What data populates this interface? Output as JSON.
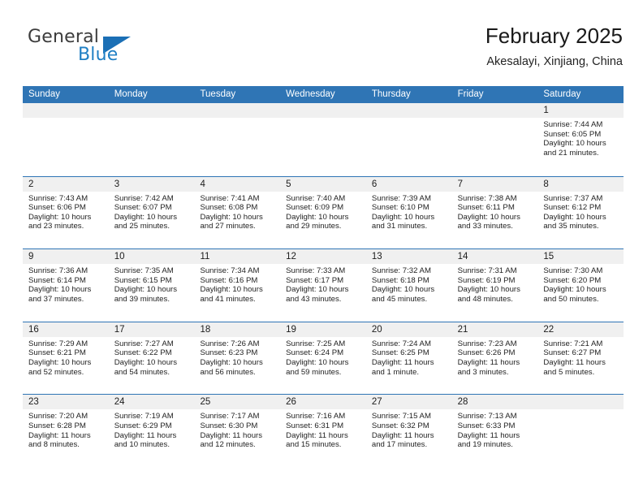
{
  "logo": {
    "text_top": "General",
    "text_bottom": "Blue",
    "colors": {
      "dark": "#3c3c3c",
      "blue": "#1f7fc4",
      "triangle": "#1b6fb5"
    }
  },
  "header": {
    "title": "February 2025",
    "subtitle": "Akesalayi, Xinjiang, China"
  },
  "theme": {
    "header_blue": "#2f75b5",
    "day_band_gray": "#f0f0f0",
    "text": "#232323"
  },
  "calendar": {
    "weekday_headers": [
      "Sunday",
      "Monday",
      "Tuesday",
      "Wednesday",
      "Thursday",
      "Friday",
      "Saturday"
    ],
    "labels": {
      "sunrise": "Sunrise:",
      "sunset": "Sunset:",
      "daylight": "Daylight:"
    },
    "weeks": [
      [
        {
          "day": ""
        },
        {
          "day": ""
        },
        {
          "day": ""
        },
        {
          "day": ""
        },
        {
          "day": ""
        },
        {
          "day": ""
        },
        {
          "day": "1",
          "sunrise": "Sunrise: 7:44 AM",
          "sunset": "Sunset: 6:05 PM",
          "daylight": "Daylight: 10 hours and 21 minutes."
        }
      ],
      [
        {
          "day": "2",
          "sunrise": "Sunrise: 7:43 AM",
          "sunset": "Sunset: 6:06 PM",
          "daylight": "Daylight: 10 hours and 23 minutes."
        },
        {
          "day": "3",
          "sunrise": "Sunrise: 7:42 AM",
          "sunset": "Sunset: 6:07 PM",
          "daylight": "Daylight: 10 hours and 25 minutes."
        },
        {
          "day": "4",
          "sunrise": "Sunrise: 7:41 AM",
          "sunset": "Sunset: 6:08 PM",
          "daylight": "Daylight: 10 hours and 27 minutes."
        },
        {
          "day": "5",
          "sunrise": "Sunrise: 7:40 AM",
          "sunset": "Sunset: 6:09 PM",
          "daylight": "Daylight: 10 hours and 29 minutes."
        },
        {
          "day": "6",
          "sunrise": "Sunrise: 7:39 AM",
          "sunset": "Sunset: 6:10 PM",
          "daylight": "Daylight: 10 hours and 31 minutes."
        },
        {
          "day": "7",
          "sunrise": "Sunrise: 7:38 AM",
          "sunset": "Sunset: 6:11 PM",
          "daylight": "Daylight: 10 hours and 33 minutes."
        },
        {
          "day": "8",
          "sunrise": "Sunrise: 7:37 AM",
          "sunset": "Sunset: 6:12 PM",
          "daylight": "Daylight: 10 hours and 35 minutes."
        }
      ],
      [
        {
          "day": "9",
          "sunrise": "Sunrise: 7:36 AM",
          "sunset": "Sunset: 6:14 PM",
          "daylight": "Daylight: 10 hours and 37 minutes."
        },
        {
          "day": "10",
          "sunrise": "Sunrise: 7:35 AM",
          "sunset": "Sunset: 6:15 PM",
          "daylight": "Daylight: 10 hours and 39 minutes."
        },
        {
          "day": "11",
          "sunrise": "Sunrise: 7:34 AM",
          "sunset": "Sunset: 6:16 PM",
          "daylight": "Daylight: 10 hours and 41 minutes."
        },
        {
          "day": "12",
          "sunrise": "Sunrise: 7:33 AM",
          "sunset": "Sunset: 6:17 PM",
          "daylight": "Daylight: 10 hours and 43 minutes."
        },
        {
          "day": "13",
          "sunrise": "Sunrise: 7:32 AM",
          "sunset": "Sunset: 6:18 PM",
          "daylight": "Daylight: 10 hours and 45 minutes."
        },
        {
          "day": "14",
          "sunrise": "Sunrise: 7:31 AM",
          "sunset": "Sunset: 6:19 PM",
          "daylight": "Daylight: 10 hours and 48 minutes."
        },
        {
          "day": "15",
          "sunrise": "Sunrise: 7:30 AM",
          "sunset": "Sunset: 6:20 PM",
          "daylight": "Daylight: 10 hours and 50 minutes."
        }
      ],
      [
        {
          "day": "16",
          "sunrise": "Sunrise: 7:29 AM",
          "sunset": "Sunset: 6:21 PM",
          "daylight": "Daylight: 10 hours and 52 minutes."
        },
        {
          "day": "17",
          "sunrise": "Sunrise: 7:27 AM",
          "sunset": "Sunset: 6:22 PM",
          "daylight": "Daylight: 10 hours and 54 minutes."
        },
        {
          "day": "18",
          "sunrise": "Sunrise: 7:26 AM",
          "sunset": "Sunset: 6:23 PM",
          "daylight": "Daylight: 10 hours and 56 minutes."
        },
        {
          "day": "19",
          "sunrise": "Sunrise: 7:25 AM",
          "sunset": "Sunset: 6:24 PM",
          "daylight": "Daylight: 10 hours and 59 minutes."
        },
        {
          "day": "20",
          "sunrise": "Sunrise: 7:24 AM",
          "sunset": "Sunset: 6:25 PM",
          "daylight": "Daylight: 11 hours and 1 minute."
        },
        {
          "day": "21",
          "sunrise": "Sunrise: 7:23 AM",
          "sunset": "Sunset: 6:26 PM",
          "daylight": "Daylight: 11 hours and 3 minutes."
        },
        {
          "day": "22",
          "sunrise": "Sunrise: 7:21 AM",
          "sunset": "Sunset: 6:27 PM",
          "daylight": "Daylight: 11 hours and 5 minutes."
        }
      ],
      [
        {
          "day": "23",
          "sunrise": "Sunrise: 7:20 AM",
          "sunset": "Sunset: 6:28 PM",
          "daylight": "Daylight: 11 hours and 8 minutes."
        },
        {
          "day": "24",
          "sunrise": "Sunrise: 7:19 AM",
          "sunset": "Sunset: 6:29 PM",
          "daylight": "Daylight: 11 hours and 10 minutes."
        },
        {
          "day": "25",
          "sunrise": "Sunrise: 7:17 AM",
          "sunset": "Sunset: 6:30 PM",
          "daylight": "Daylight: 11 hours and 12 minutes."
        },
        {
          "day": "26",
          "sunrise": "Sunrise: 7:16 AM",
          "sunset": "Sunset: 6:31 PM",
          "daylight": "Daylight: 11 hours and 15 minutes."
        },
        {
          "day": "27",
          "sunrise": "Sunrise: 7:15 AM",
          "sunset": "Sunset: 6:32 PM",
          "daylight": "Daylight: 11 hours and 17 minutes."
        },
        {
          "day": "28",
          "sunrise": "Sunrise: 7:13 AM",
          "sunset": "Sunset: 6:33 PM",
          "daylight": "Daylight: 11 hours and 19 minutes."
        },
        {
          "day": ""
        }
      ]
    ]
  }
}
